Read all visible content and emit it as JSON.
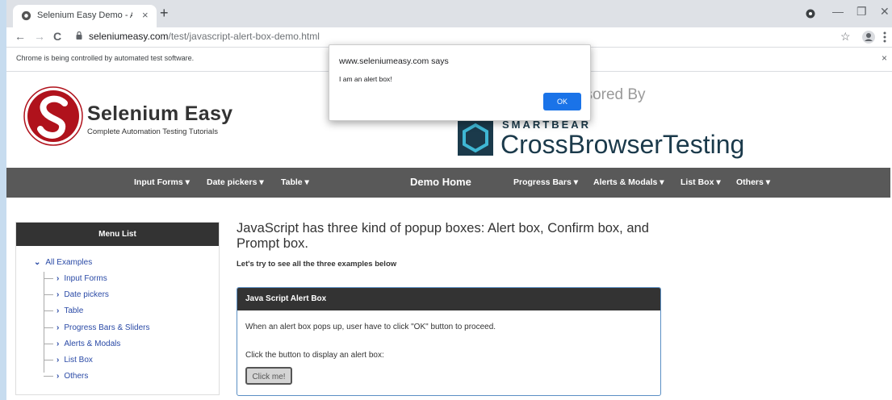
{
  "browser": {
    "tab_title": "Selenium Easy Demo - Automate",
    "tab_close": "×",
    "new_tab": "+",
    "url_host": "seleniumeasy.com",
    "url_path": "/test/javascript-alert-box-demo.html",
    "back": "←",
    "forward": "→",
    "reload": "C",
    "star": "☆",
    "minimize": "—",
    "restore": "❐",
    "close": "✕",
    "infobar_text": "Chrome is being controlled by automated test software.",
    "infobar_close": "×"
  },
  "header": {
    "brand_name": "Selenium Easy",
    "brand_tagline": "Complete Automation Testing Tutorials",
    "sponsor_text": "nsored By",
    "sponsor_brand_small": "SMARTBEAR",
    "sponsor_brand_big": "CrossBrowserTesting"
  },
  "nav": {
    "items": [
      "Input Forms ▾",
      "Date pickers ▾",
      "Table ▾",
      "Demo Home",
      "Progress Bars ▾",
      "Alerts & Modals ▾",
      "List Box ▾",
      "Others ▾"
    ]
  },
  "sidebar": {
    "title": "Menu List",
    "root": "All Examples",
    "items": [
      "Input Forms",
      "Date pickers",
      "Table",
      "Progress Bars & Sliders",
      "Alerts & Modals",
      "List Box",
      "Others"
    ]
  },
  "main": {
    "heading": "JavaScript has three kind of popup boxes: Alert box, Confirm box, and Prompt box.",
    "subline": "Let's try to see all the three examples below",
    "panel": {
      "title": "Java Script Alert Box",
      "line1": "When an alert box pops up, user have to click \"OK\" button to proceed.",
      "line2": "Click the button to display an alert box:",
      "button": "Click me!"
    }
  },
  "alert": {
    "origin": "www.seleniumeasy.com says",
    "message": "I am an alert box!",
    "ok": "OK"
  },
  "colors": {
    "nav_bg": "#595959",
    "panel_head_bg": "#333333",
    "link": "#2a4aa6",
    "ok_button": "#1a73e8",
    "logo_red": "#b0121c",
    "sponsor_navy": "#1b3a4b"
  }
}
